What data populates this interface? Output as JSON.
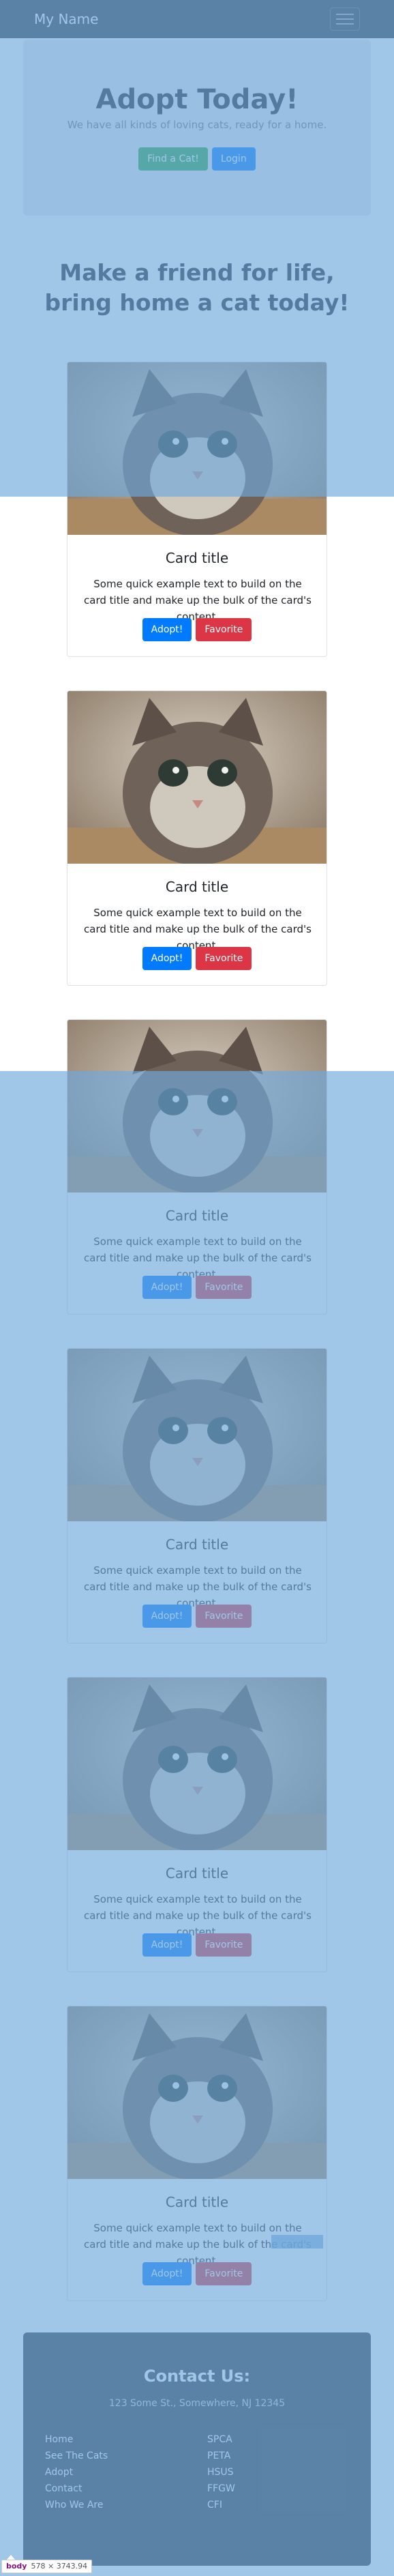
{
  "navbar": {
    "brand": "My Name",
    "toggler_icon": "hamburger-menu-icon"
  },
  "jumbotron": {
    "title": "Adopt Today!",
    "subtitle": "We have all kinds of loving cats, ready for a home.",
    "find_button": "Find a Cat!",
    "login_button": "Login"
  },
  "headline": {
    "line1": "Make a friend for life,",
    "line2": "bring home a cat today!"
  },
  "cards": [
    {
      "title": "Card title",
      "text": "Some quick example text to build on the card title and make up the bulk of the card's content.",
      "adopt": "Adopt!",
      "favorite": "Favorite"
    },
    {
      "title": "Card title",
      "text": "Some quick example text to build on the card title and make up the bulk of the card's content.",
      "adopt": "Adopt!",
      "favorite": "Favorite"
    },
    {
      "title": "Card title",
      "text": "Some quick example text to build on the card title and make up the bulk of the card's content.",
      "adopt": "Adopt!",
      "favorite": "Favorite"
    },
    {
      "title": "Card title",
      "text": "Some quick example text to build on the card title and make up the bulk of the card's content.",
      "adopt": "Adopt!",
      "favorite": "Favorite"
    },
    {
      "title": "Card title",
      "text": "Some quick example text to build on the card title and make up the bulk of the card's content.",
      "adopt": "Adopt!",
      "favorite": "Favorite"
    },
    {
      "title": "Card title",
      "text": "Some quick example text to build on the card title and make up the bulk of the card's content.",
      "adopt": "Adopt!",
      "favorite": "Favorite"
    }
  ],
  "footer": {
    "title": "Contact Us:",
    "address": "123 Some St., Somewhere, NJ 12345",
    "left_links": [
      "Home",
      "See The Cats",
      "Adopt",
      "Contact",
      "Who We Are"
    ],
    "right_links": [
      "SPCA",
      "PETA",
      "HSUS",
      "FFGW",
      "CFI"
    ]
  },
  "devtools_tooltip": {
    "tag": "body",
    "dims": "578 × 3743.94"
  },
  "colors": {
    "navbar": "#343a40",
    "primary": "#007bff",
    "success": "#28a745",
    "danger": "#dc3545",
    "highlight_overlay": "#6fa8dc"
  }
}
